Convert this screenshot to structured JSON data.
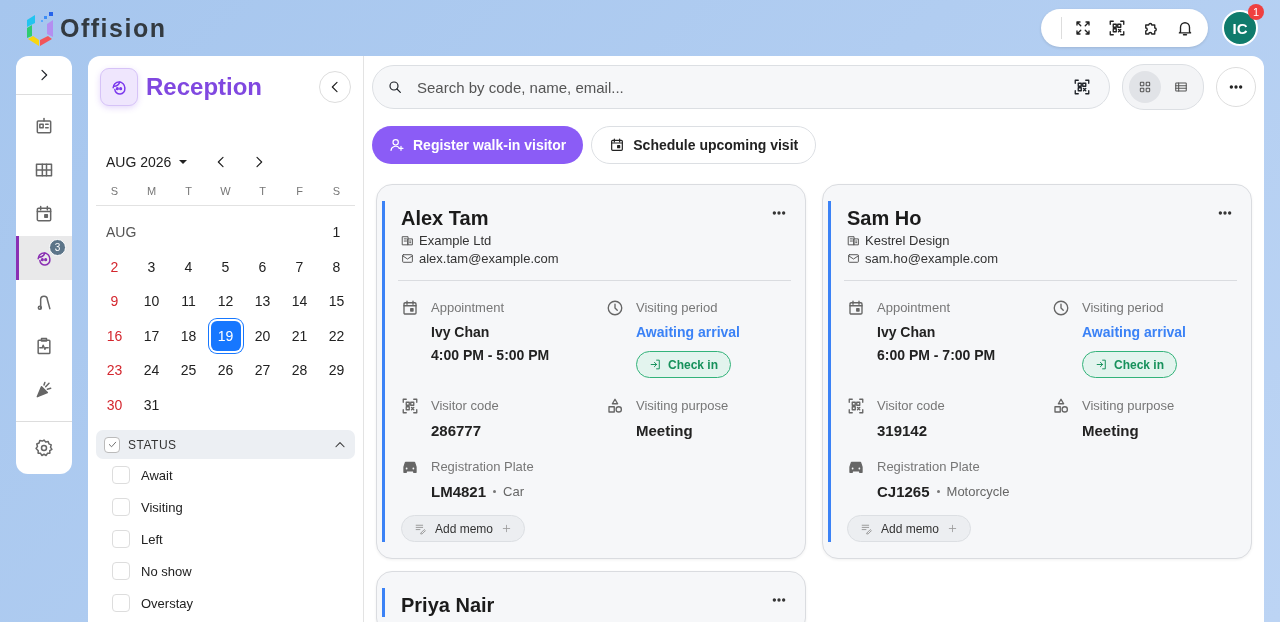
{
  "app": {
    "name": "Offision"
  },
  "account": {
    "initials": "IC",
    "badge": "1"
  },
  "rail": {
    "items": [
      {
        "selected": false
      },
      {
        "selected": false
      },
      {
        "selected": false
      },
      {
        "selected": true,
        "badge": "3"
      },
      {
        "selected": false
      },
      {
        "selected": false
      },
      {
        "selected": false
      }
    ]
  },
  "reception": {
    "title": "Reception"
  },
  "calendar": {
    "month": "AUG 2026",
    "month_short": "AUG",
    "weekdays": [
      "S",
      "M",
      "T",
      "W",
      "T",
      "F",
      "S"
    ],
    "weeks": [
      [
        {
          "day": "1",
          "sunday": false,
          "selected": false
        }
      ],
      [
        {
          "day": "2",
          "sunday": true,
          "selected": false
        },
        {
          "day": "3",
          "sunday": false,
          "selected": false
        },
        {
          "day": "4",
          "sunday": false,
          "selected": false
        },
        {
          "day": "5",
          "sunday": false,
          "selected": false
        },
        {
          "day": "6",
          "sunday": false,
          "selected": false
        },
        {
          "day": "7",
          "sunday": false,
          "selected": false
        },
        {
          "day": "8",
          "sunday": false,
          "selected": false
        }
      ],
      [
        {
          "day": "9",
          "sunday": true,
          "selected": false
        },
        {
          "day": "10",
          "sunday": false,
          "selected": false
        },
        {
          "day": "11",
          "sunday": false,
          "selected": false
        },
        {
          "day": "12",
          "sunday": false,
          "selected": false
        },
        {
          "day": "13",
          "sunday": false,
          "selected": false
        },
        {
          "day": "14",
          "sunday": false,
          "selected": false
        },
        {
          "day": "15",
          "sunday": false,
          "selected": false
        }
      ],
      [
        {
          "day": "16",
          "sunday": true,
          "selected": false
        },
        {
          "day": "17",
          "sunday": false,
          "selected": false
        },
        {
          "day": "18",
          "sunday": false,
          "selected": false
        },
        {
          "day": "19",
          "sunday": false,
          "selected": true
        },
        {
          "day": "20",
          "sunday": false,
          "selected": false
        },
        {
          "day": "21",
          "sunday": false,
          "selected": false
        },
        {
          "day": "22",
          "sunday": false,
          "selected": false
        }
      ],
      [
        {
          "day": "23",
          "sunday": true,
          "selected": false
        },
        {
          "day": "24",
          "sunday": false,
          "selected": false
        },
        {
          "day": "25",
          "sunday": false,
          "selected": false
        },
        {
          "day": "26",
          "sunday": false,
          "selected": false
        },
        {
          "day": "27",
          "sunday": false,
          "selected": false
        },
        {
          "day": "28",
          "sunday": false,
          "selected": false
        },
        {
          "day": "29",
          "sunday": false,
          "selected": false
        }
      ],
      [
        {
          "day": "30",
          "sunday": true,
          "selected": false
        },
        {
          "day": "31",
          "sunday": false,
          "selected": false
        }
      ]
    ]
  },
  "status_filter": {
    "label": "STATUS",
    "checked": true,
    "expanded": true,
    "options": [
      {
        "label": "Await",
        "checked": false
      },
      {
        "label": "Visiting",
        "checked": false
      },
      {
        "label": "Left",
        "checked": false
      },
      {
        "label": "No show",
        "checked": false
      },
      {
        "label": "Overstay",
        "checked": false
      }
    ]
  },
  "search": {
    "placeholder": "Search by code, name, email..."
  },
  "view_toggle": [
    {
      "kind": "grid",
      "selected": true
    },
    {
      "kind": "list",
      "selected": false
    }
  ],
  "actions": {
    "register": "Register walk-in visitor",
    "schedule": "Schedule upcoming visit"
  },
  "visits": [
    {
      "name": "Alex Tam",
      "company": "Example Ltd",
      "email": "alex.tam@example.com",
      "appointment": {
        "label": "Appointment",
        "host": "Ivy Chan",
        "time": "4:00 PM - 5:00 PM"
      },
      "period": {
        "label": "Visiting period",
        "status": "Awaiting arrival",
        "action": "Check in"
      },
      "code": {
        "label": "Visitor code",
        "value": "286777"
      },
      "purpose": {
        "label": "Visiting purpose",
        "value": "Meeting"
      },
      "plate": {
        "label": "Registration Plate",
        "value": "LM4821",
        "vehicle": "Car"
      },
      "memo": "Add memo"
    },
    {
      "name": "Sam Ho",
      "company": "Kestrel Design",
      "email": "sam.ho@example.com",
      "appointment": {
        "label": "Appointment",
        "host": "Ivy Chan",
        "time": "6:00 PM - 7:00 PM"
      },
      "period": {
        "label": "Visiting period",
        "status": "Awaiting arrival",
        "action": "Check in"
      },
      "code": {
        "label": "Visitor code",
        "value": "319142"
      },
      "purpose": {
        "label": "Visiting purpose",
        "value": "Meeting"
      },
      "plate": {
        "label": "Registration Plate",
        "value": "CJ1265",
        "vehicle": "Motorcycle"
      },
      "memo": "Add memo"
    },
    {
      "name": "Priya Nair"
    }
  ]
}
